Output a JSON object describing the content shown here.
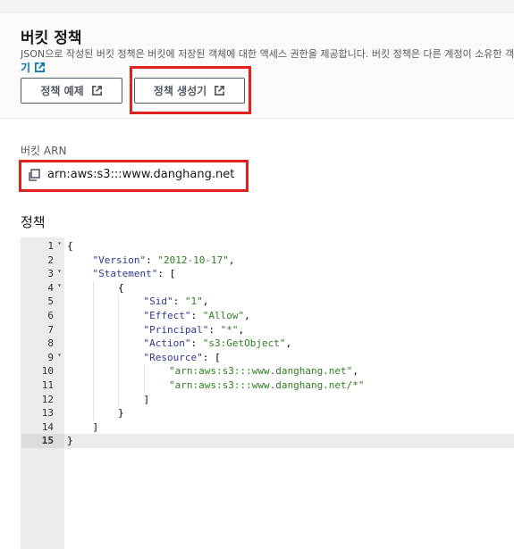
{
  "header": {
    "title": "버킷 정책",
    "description": "JSON으로 작성된 버킷 정책은 버킷에 저장된 객체에 대한 액세스 권한을 제공합니다. 버킷 정책은 다른 계정이 소유한 객",
    "description_cont": "기",
    "buttons": {
      "example_label": "정책 예제",
      "generator_label": "정책 생성기"
    }
  },
  "arn": {
    "label": "버킷 ARN",
    "value": "arn:aws:s3:::www.danghang.net"
  },
  "policy": {
    "label": "정책",
    "active_line": 15,
    "lines": [
      {
        "n": "1",
        "fold": true,
        "indent": 0,
        "parts": [
          {
            "t": "{",
            "c": "p"
          }
        ]
      },
      {
        "n": "2",
        "fold": false,
        "indent": 1,
        "parts": [
          {
            "t": "\"Version\"",
            "c": "k"
          },
          {
            "t": ": ",
            "c": "p"
          },
          {
            "t": "\"2012-10-17\"",
            "c": "s"
          },
          {
            "t": ",",
            "c": "p"
          }
        ]
      },
      {
        "n": "3",
        "fold": true,
        "indent": 1,
        "parts": [
          {
            "t": "\"Statement\"",
            "c": "k"
          },
          {
            "t": ": [",
            "c": "p"
          }
        ]
      },
      {
        "n": "4",
        "fold": true,
        "indent": 2,
        "parts": [
          {
            "t": "{",
            "c": "p"
          }
        ]
      },
      {
        "n": "5",
        "fold": false,
        "indent": 3,
        "parts": [
          {
            "t": "\"Sid\"",
            "c": "k"
          },
          {
            "t": ": ",
            "c": "p"
          },
          {
            "t": "\"1\"",
            "c": "s"
          },
          {
            "t": ",",
            "c": "p"
          }
        ]
      },
      {
        "n": "6",
        "fold": false,
        "indent": 3,
        "parts": [
          {
            "t": "\"Effect\"",
            "c": "k"
          },
          {
            "t": ": ",
            "c": "p"
          },
          {
            "t": "\"Allow\"",
            "c": "s"
          },
          {
            "t": ",",
            "c": "p"
          }
        ]
      },
      {
        "n": "7",
        "fold": false,
        "indent": 3,
        "parts": [
          {
            "t": "\"Principal\"",
            "c": "k"
          },
          {
            "t": ": ",
            "c": "p"
          },
          {
            "t": "\"*\"",
            "c": "s"
          },
          {
            "t": ",",
            "c": "p"
          }
        ]
      },
      {
        "n": "8",
        "fold": false,
        "indent": 3,
        "parts": [
          {
            "t": "\"Action\"",
            "c": "k"
          },
          {
            "t": ": ",
            "c": "p"
          },
          {
            "t": "\"s3:GetObject\"",
            "c": "s"
          },
          {
            "t": ",",
            "c": "p"
          }
        ]
      },
      {
        "n": "9",
        "fold": true,
        "indent": 3,
        "parts": [
          {
            "t": "\"Resource\"",
            "c": "k"
          },
          {
            "t": ": [",
            "c": "p"
          }
        ]
      },
      {
        "n": "10",
        "fold": false,
        "indent": 4,
        "parts": [
          {
            "t": "\"arn:aws:s3:::www.danghang.net\"",
            "c": "s"
          },
          {
            "t": ",",
            "c": "p"
          }
        ]
      },
      {
        "n": "11",
        "fold": false,
        "indent": 4,
        "parts": [
          {
            "t": "\"arn:aws:s3:::www.danghang.net/*\"",
            "c": "s"
          }
        ]
      },
      {
        "n": "12",
        "fold": false,
        "indent": 3,
        "parts": [
          {
            "t": "]",
            "c": "p"
          }
        ]
      },
      {
        "n": "13",
        "fold": false,
        "indent": 2,
        "parts": [
          {
            "t": "}",
            "c": "p"
          }
        ]
      },
      {
        "n": "14",
        "fold": false,
        "indent": 1,
        "parts": [
          {
            "t": "]",
            "c": "p"
          }
        ]
      },
      {
        "n": "15",
        "fold": false,
        "indent": 0,
        "parts": [
          {
            "t": "}",
            "c": "p"
          }
        ]
      }
    ]
  },
  "colors": {
    "highlight": "#e0211d",
    "link": "#0073bb",
    "json_key": "#2a3a8f",
    "json_string": "#2d7d1e"
  },
  "icons": {
    "external_link": "external-link-icon",
    "copy": "copy-icon"
  }
}
